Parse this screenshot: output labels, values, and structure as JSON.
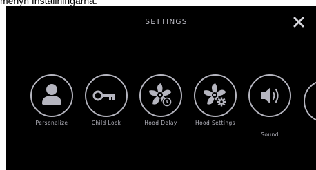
{
  "caption": "menyn Installningarna.",
  "settings": {
    "title": "SETTINGS",
    "close_label": "✕",
    "options": [
      {
        "label": "Personalize",
        "icon": "person-icon"
      },
      {
        "label": "Child Lock",
        "icon": "key-icon"
      },
      {
        "label": "Hood Delay",
        "icon": "fan-timer-icon"
      },
      {
        "label": "Hood Settings",
        "icon": "fan-gear-icon"
      },
      {
        "label": "Sound",
        "icon": "speaker-icon"
      }
    ]
  },
  "colors": {
    "background": "#000000",
    "foreground": "#b5b5bf",
    "close": "#d6d6dc"
  }
}
